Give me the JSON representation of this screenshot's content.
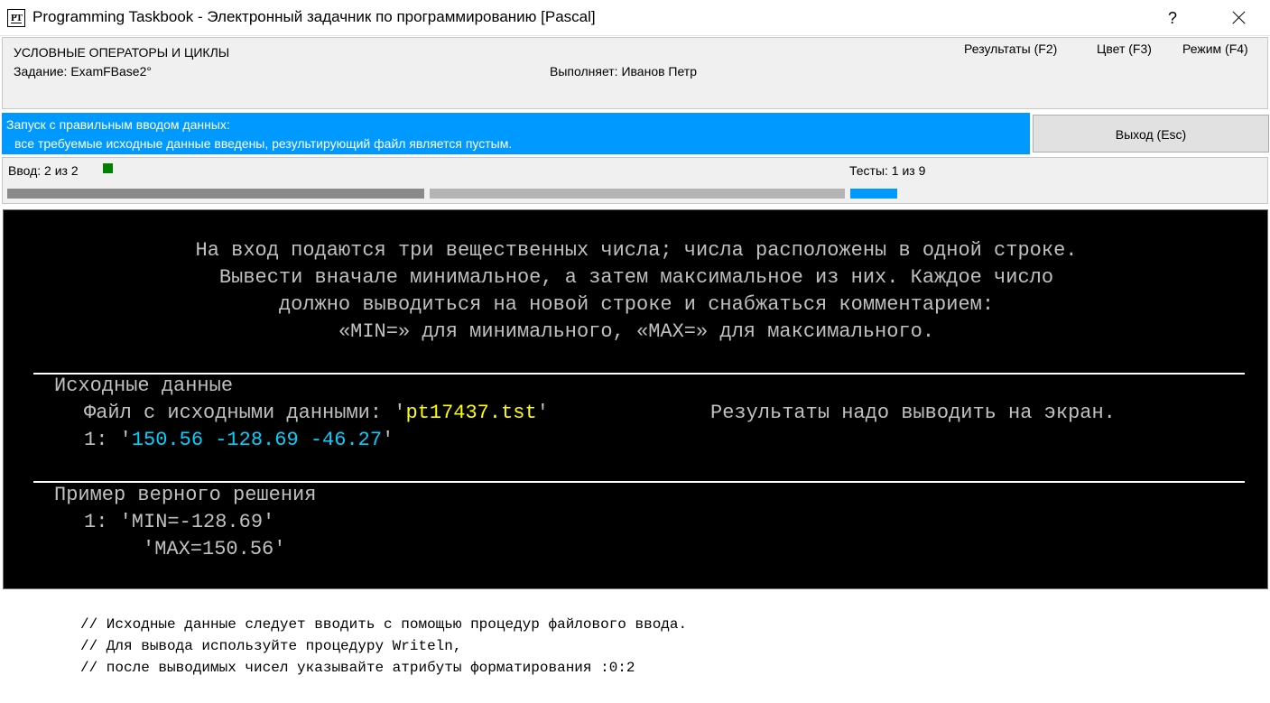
{
  "window": {
    "icon_text": "PT",
    "title": "Programming Taskbook - Электронный задачник по программированию [Pascal]",
    "help": "?"
  },
  "header": {
    "section": "УСЛОВНЫЕ ОПЕРАТОРЫ И ЦИКЛЫ",
    "task": "Задание: ExamFBase2°",
    "performer": "Выполняет: Иванов Петр",
    "menu_results": "Результаты (F2)",
    "menu_color": "Цвет (F3)",
    "menu_mode": "Режим (F4)"
  },
  "status": {
    "line1": "Запуск с правильным вводом данных:",
    "line2": "все требуемые исходные данные введены, результирующий файл является пустым.",
    "exit_label": "Выход (Esc)",
    "color": "#0099ff"
  },
  "progress": {
    "input_label": "Ввод:  2 из 2",
    "input_done": 2,
    "input_total": 2,
    "tests_label": "Тесты:  1 из 9",
    "tests_done": 1,
    "tests_total": 9
  },
  "console": {
    "task_lines": [
      "На вход подаются три вещественных числа; числа расположены в одной строке.",
      "Вывести вначале минимальное, а затем максимальное из них. Каждое число",
      "должно выводиться на новой строке и снабжаться комментарием:",
      "«MIN=» для минимального, «MAX=» для максимального."
    ],
    "input_heading": "Исходные данные",
    "file_prefix": "Файл с исходными данными: '",
    "file_name": "pt17437.tst",
    "file_suffix": "'",
    "screen_note": "Результаты надо выводить на экран.",
    "data_prefix": "1: '",
    "data_values": "150.56 -128.69 -46.27",
    "data_suffix": "'",
    "example_heading": "Пример верного решения",
    "example_line1": "1: 'MIN=-128.69'",
    "example_line2": "'MAX=150.56'"
  },
  "hints": [
    "// Исходные данные следует вводить с помощью процедур файлового ввода.",
    "// Для вывода используйте процедуру Writeln,",
    "// после выводимых чисел указывайте атрибуты форматирования :0:2"
  ]
}
